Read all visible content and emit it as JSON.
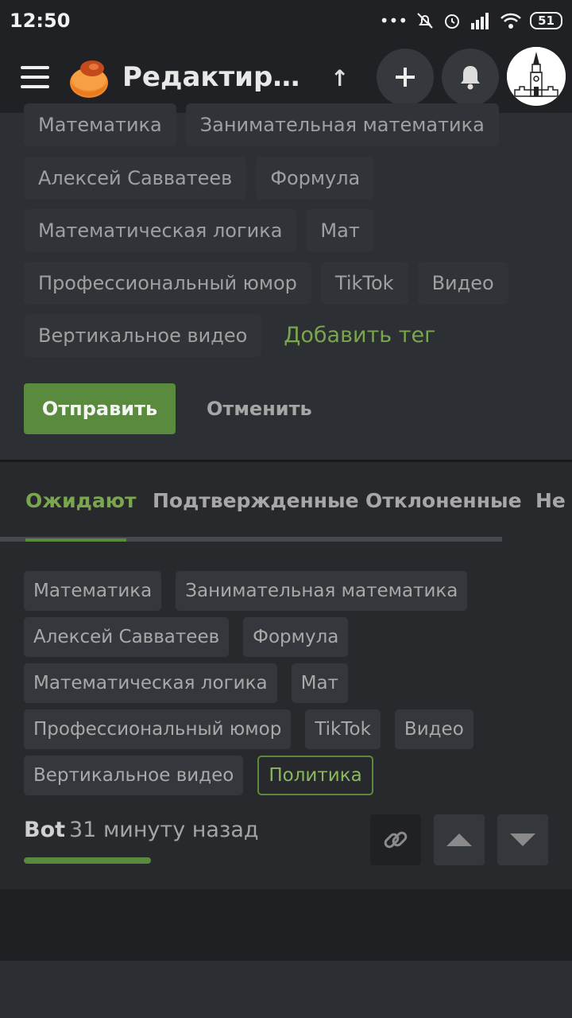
{
  "status_bar": {
    "time": "12:50",
    "battery": "51",
    "icons": [
      "dots-icon",
      "mute-icon",
      "alarm-icon",
      "signal-icon",
      "wifi-icon",
      "battery-icon"
    ]
  },
  "header": {
    "title": "Редактиров…",
    "icons": [
      "menu-icon",
      "logo-icon",
      "up-arrow-icon",
      "plus-icon",
      "bell-icon",
      "avatar-kremlin"
    ]
  },
  "edit_tags": {
    "row1": [
      "Математика",
      "Занимательная математика"
    ],
    "row2": [
      "Алексей Савватеев",
      "Формула"
    ],
    "row3": [
      "Математическая логика",
      "Мат"
    ],
    "row4": [
      "Профессиональный юмор",
      "TikTok",
      "Видео"
    ],
    "row5": [
      "Вертикальное видео"
    ],
    "add_tag": "Добавить тег",
    "submit": "Отправить",
    "cancel": "Отменить"
  },
  "tabs": [
    "Ожидают",
    "Подтвержденные",
    "Отклоненные",
    "Не п"
  ],
  "pending": {
    "row1": [
      "Математика",
      "Занимательная математика"
    ],
    "row2": [
      "Алексей Савватеев",
      "Формула"
    ],
    "row3": [
      "Математическая логика",
      "Мат"
    ],
    "row4": [
      "Профессиональный юмор",
      "TikTok",
      "Видео"
    ],
    "row5": [
      "Вертикальное видео"
    ],
    "new_tag": "Политика",
    "author": "Bot",
    "time": "31 минуту назад"
  },
  "colors": {
    "accent": "#5a8a3e",
    "accent_text": "#7aa64e",
    "background": "#1f2124",
    "panel": "#2c2f33"
  }
}
